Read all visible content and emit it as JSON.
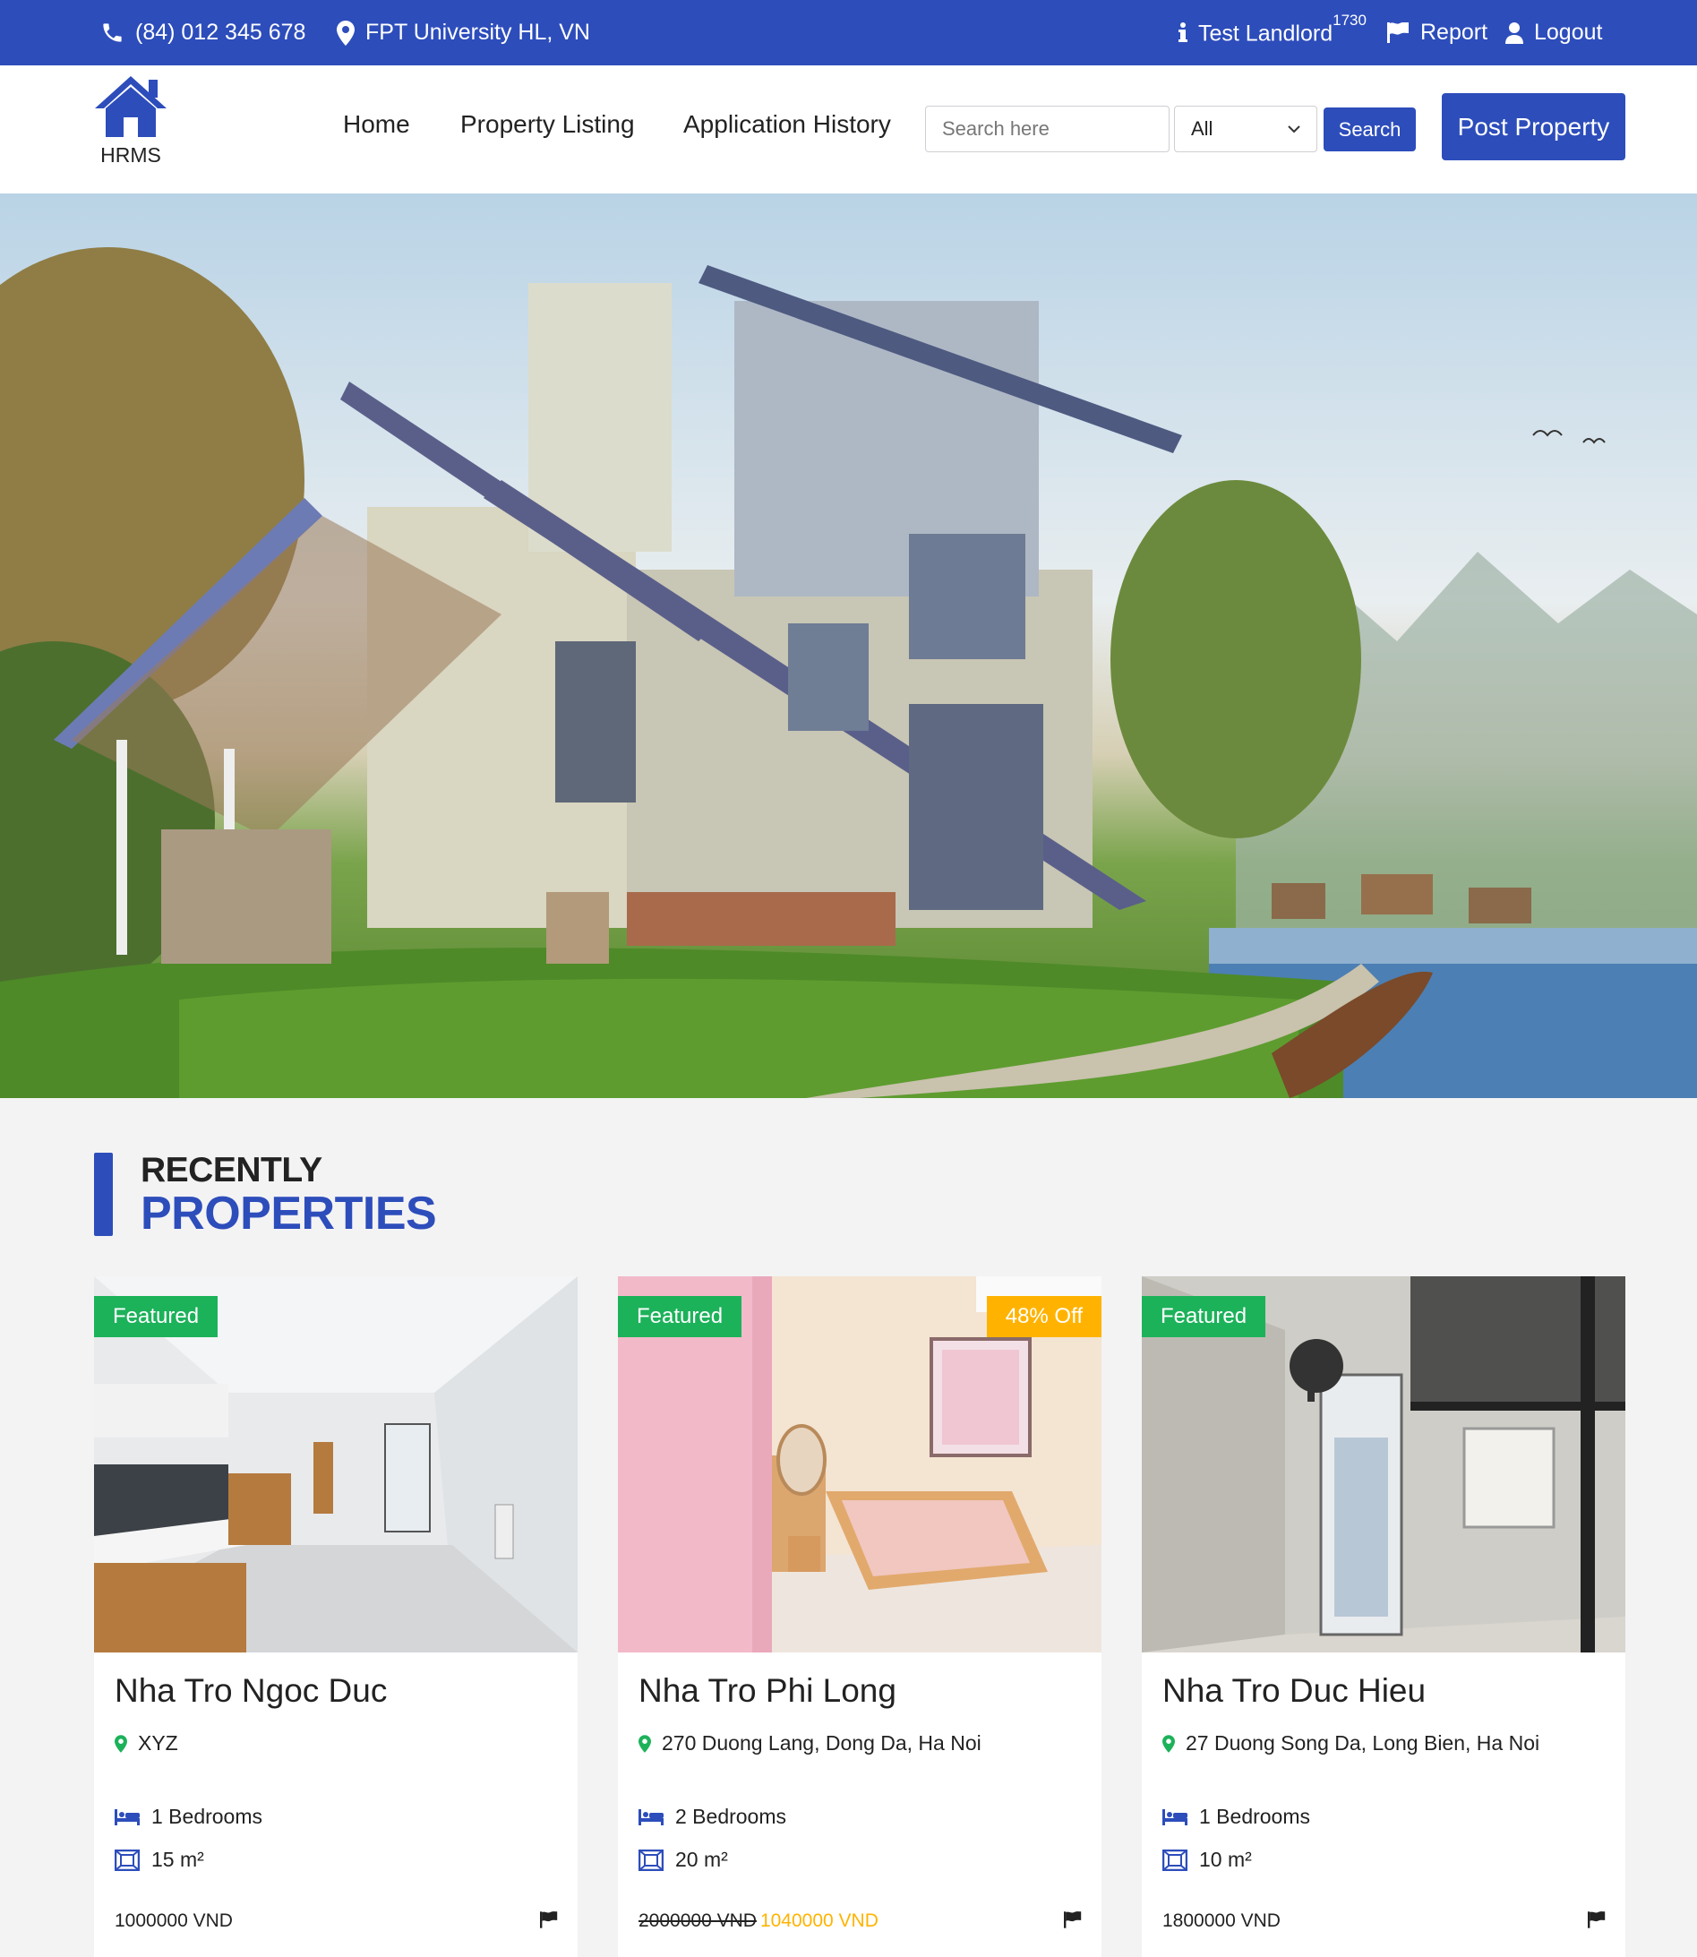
{
  "topbar": {
    "phone": "(84) 012 345 678",
    "location": "FPT University HL, VN",
    "user": "Test Landlord",
    "user_sup": "1730",
    "report": "Report",
    "logout": "Logout"
  },
  "nav": {
    "logo_text": "HRMS",
    "links": [
      "Home",
      "Property Listing",
      "Application History"
    ],
    "search_placeholder": "Search here",
    "select_value": "All",
    "search_button": "Search",
    "post_button": "Post Property"
  },
  "section": {
    "title_line1": "RECENTLY",
    "title_line2": "PROPERTIES"
  },
  "cards": [
    {
      "badge": "Featured",
      "title": "Nha Tro Ngoc Duc",
      "location": "XYZ",
      "bedrooms": "1 Bedrooms",
      "area": "15 m²",
      "price": "1000000 VND"
    },
    {
      "badge": "Featured",
      "discount": "48% Off",
      "title": "Nha Tro Phi Long",
      "location": "270 Duong Lang, Dong Da, Ha Noi",
      "bedrooms": "2 Bedrooms",
      "area": "20 m²",
      "old_price": "2000000 VND",
      "price": "1040000 VND"
    },
    {
      "badge": "Featured",
      "title": "Nha Tro Duc Hieu",
      "location": "27 Duong Song Da, Long Bien, Ha Noi",
      "bedrooms": "1 Bedrooms",
      "area": "10 m²",
      "price": "1800000 VND"
    }
  ],
  "colors": {
    "primary": "#2d4dbb",
    "featured": "#1cb25a",
    "discount": "#ffb300",
    "page_bg": "#f3f3f4"
  }
}
